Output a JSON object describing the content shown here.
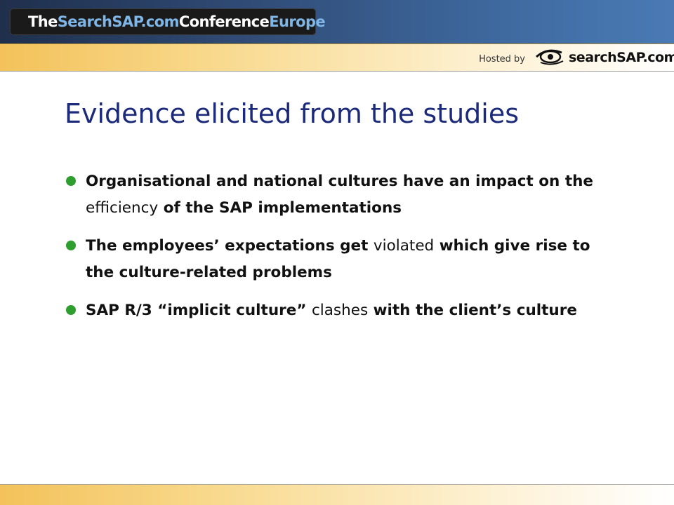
{
  "header": {
    "banner_part1": "The ",
    "banner_part2": "SearchSAP.com",
    "banner_part3": " Conference ",
    "banner_part4": "Europe",
    "hosted_by": "Hosted by",
    "logo_text": "searchSAP.com"
  },
  "slide": {
    "title": "Evidence elicited from the studies",
    "bullets": [
      {
        "segments": [
          {
            "text": " Organisational and national cultures have an impact on the ",
            "bold": true
          },
          {
            "text": "efficiency",
            "bold": false
          },
          {
            "text": " of the SAP implementations",
            "bold": true
          }
        ]
      },
      {
        "segments": [
          {
            "text": "The employees’ expectations get ",
            "bold": true
          },
          {
            "text": "violated",
            "bold": false
          },
          {
            "text": " which give rise to the culture-related problems",
            "bold": true
          }
        ]
      },
      {
        "segments": [
          {
            "text": "SAP R/3 “implicit culture” ",
            "bold": true
          },
          {
            "text": "clashes",
            "bold": false
          },
          {
            "text": " with the client’s culture",
            "bold": true
          }
        ]
      }
    ]
  },
  "colors": {
    "title": "#1c2a7a",
    "bullet_dot": "#2e9e2e",
    "banner_accent": "#7fb6e8"
  }
}
